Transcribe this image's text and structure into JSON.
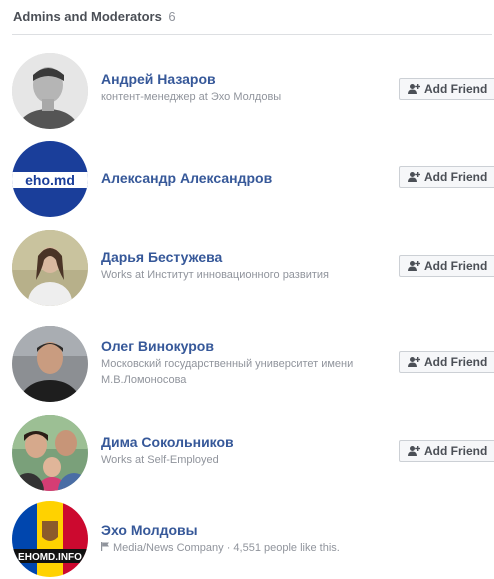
{
  "header": {
    "title": "Admins and Moderators",
    "count": "6"
  },
  "members": [
    {
      "name": "Андрей Назаров",
      "subtitle": "контент-менеджер at Эхо Молдовы",
      "button": "Add Friend"
    },
    {
      "name": "Александр Александров",
      "subtitle": "",
      "button": "Add Friend",
      "avatar_text": "eho.md"
    },
    {
      "name": "Дарья Бестужева",
      "subtitle": "Works at Институт инновационного развития",
      "button": "Add Friend"
    },
    {
      "name": "Олег Винокуров",
      "subtitle": "Московский государственный университет имени М.В.Ломоносова",
      "button": "Add Friend"
    },
    {
      "name": "Дима Сокольников",
      "subtitle": "Works at Self-Employed",
      "button": "Add Friend"
    },
    {
      "name": "Эхо Молдовы",
      "subtitle": "Media/News Company · 4,551 people like this.",
      "avatar_text": "EHOMD.INFO",
      "page_icon": "flag-icon"
    }
  ],
  "colors": {
    "link": "#365899",
    "secondary_text": "#90949c",
    "button_bg": "#f6f7f9",
    "button_border": "#ccd0d5",
    "eho_blue": "#1a3e9a"
  }
}
